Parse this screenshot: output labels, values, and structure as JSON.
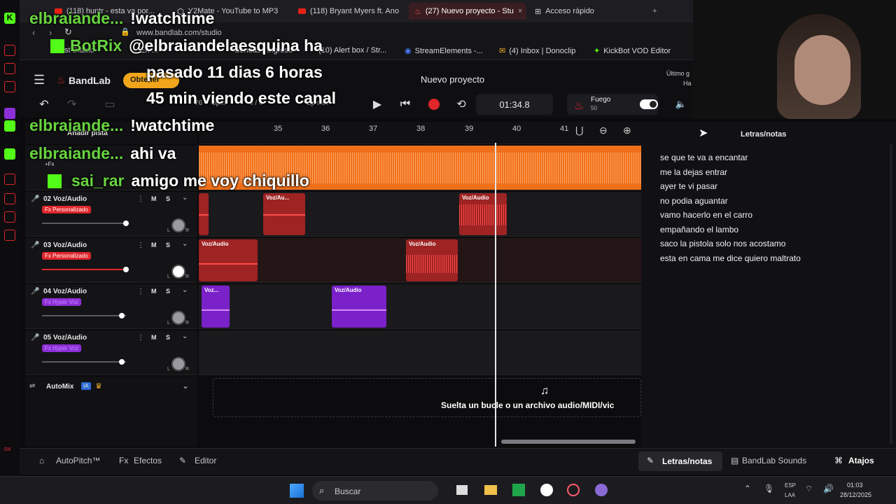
{
  "browser": {
    "tabs": [
      {
        "label": "(118) huntr - esta va por..."
      },
      {
        "label": "Y2Mate - YouTube to MP3"
      },
      {
        "label": "(118) Bryant Myers ft. Ano"
      },
      {
        "label": "(27) Nuevo proyecto - Stu"
      },
      {
        "label": "Acceso rápido"
      }
    ],
    "url": "www.bandlab.com/studio",
    "bookmarks": [
      "st Diablo",
      "En ...",
      "Sendas | Ingreso",
      "(10) Alert box / Str...",
      "StreamElements -...",
      "(4) Inbox | Donoclip",
      "KickBot VOD Editor"
    ]
  },
  "bandlab": {
    "brand": "BandLab",
    "get_button": "Obtener",
    "project_title": "Nuevo proyecto",
    "last_saved": "Último g",
    "last_saved_2": "Ha",
    "time": "01:34.8",
    "fuego_label": "Fuego",
    "fuego_value": "50",
    "bpm": "76",
    "bpm_unit": "bpm",
    "meter": "4 / 4",
    "key": "Ep min",
    "add_track": "Añadir pista",
    "ruler_ticks": [
      "35",
      "36",
      "37",
      "38",
      "39",
      "40",
      "41"
    ]
  },
  "tracks": [
    {
      "number": "02",
      "name": "Voz/Audio",
      "fx": "Fx Personalizado",
      "fx_color": "#e0262b",
      "m": "M",
      "s": "S",
      "l": "L",
      "r": "R",
      "volume": 0.8,
      "clips": [
        {
          "title": "Voz/Au..."
        },
        {
          "title": "Voz/Audio"
        }
      ]
    },
    {
      "number": "03",
      "name": "Voz/Audio",
      "fx": "Fx Personalizado",
      "fx_color": "#e0262b",
      "m": "M",
      "s": "S",
      "l": "L",
      "r": "R",
      "volume": 0.8,
      "clips": [
        {
          "title": "Voz/Audio"
        },
        {
          "title": "Voz/Audio"
        }
      ]
    },
    {
      "number": "04",
      "name": "Voz/Audio",
      "fx": "Fx Hyper Voz",
      "fx_color": "#8d2fd6",
      "m": "M",
      "s": "S",
      "l": "L",
      "r": "R",
      "volume": 0.74,
      "clips": [
        {
          "title": "Voz..."
        },
        {
          "title": "Voz/Audio"
        }
      ]
    },
    {
      "number": "05",
      "name": "Voz/Audio",
      "fx": "Fx Hyper Voz",
      "fx_color": "#8d2fd6",
      "m": "M",
      "s": "S",
      "l": "L",
      "r": "R",
      "volume": 0.74,
      "clips": []
    }
  ],
  "automix": {
    "label": "AutoMix",
    "badge": "IA"
  },
  "drop_zone": "Suelta un bucle o un archivo audio/MIDI/vic",
  "notes_panel": {
    "title": "Letras/notas",
    "lines": [
      "se que te va a encantar",
      "me la dejas  entrar",
      "ayer te vi pasar",
      "no podia aguantar",
      "vamo hacerlo en el carro",
      "empañando el lambo",
      "saco la pistola solo nos acostamo",
      "esta en cama me dice quiero maltrato"
    ]
  },
  "bottom_bar": {
    "autopitch": "AutoPitch™",
    "effects": "Efectos",
    "editor": "Editor",
    "notes": "Letras/notas",
    "sounds": "BandLab Sounds",
    "shortcuts": "Atajos"
  },
  "taskbar": {
    "search": "Buscar",
    "lang": "ESP",
    "lang2": "LAA",
    "time": "01:03",
    "date": "28/12/2025"
  },
  "chat": [
    {
      "user": "elbraiande...",
      "msg": "!watchtime"
    },
    {
      "user": "BotRix",
      "msg": "@elbraiandelaesquina ha"
    },
    {
      "user": "",
      "msg": "pasado 11 dias 6 horas"
    },
    {
      "user": "",
      "msg": "45 min viendo este canal"
    },
    {
      "user": "elbraiande...",
      "msg": "!watchtime"
    },
    {
      "user": "elbraiande...",
      "msg": "ahi va"
    },
    {
      "user": "sai_rar",
      "msg": "amigo me voy chiquillo"
    }
  ],
  "colors": {
    "kick_green": "#53fc18",
    "record_red": "#e0262b",
    "clip_red": "#9e2323",
    "clip_purple": "#7a21c9",
    "accent_orange": "#f0701a"
  }
}
